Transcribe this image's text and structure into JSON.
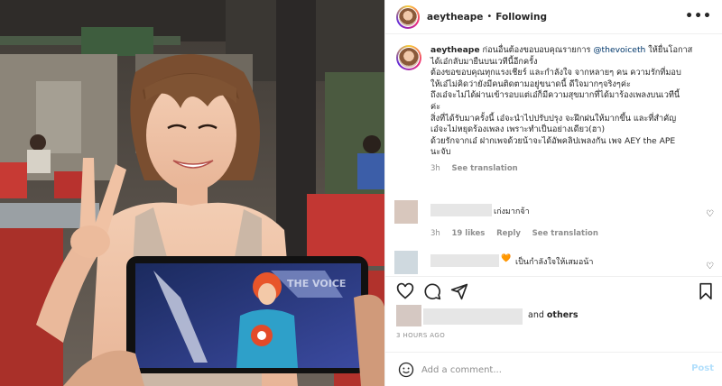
{
  "header": {
    "username": "aeytheape",
    "separator": "•",
    "follow_status": "Following",
    "more_icon": "•••"
  },
  "caption": {
    "username": "aeytheape",
    "text_before_mention": "ก่อนอื่นต้องขอบอบคุณรายการ",
    "mention": "@thevoiceth",
    "text_after_mention": "ให้ยื่นโอกาส",
    "lines": [
      "ได้เอ๋กลับมายืนบนเวทีนี้อีกครั้ง",
      "ต้องขอขอบคุณทุกแรงเชียร์ และกำลังใจ จากหลายๆ คน ความรักที่มอบ",
      "ให้เอ๋ไม่คิดว่ายังมีคนติดตามอยู่ขนาดนี้ ดีใจมากๆจริงๆค่ะ",
      "ถึงเอ๋จะไม่ได้ผ่านเข้ารอบแต่เอ๋ก็มีความสุขมากที่ได้มาร้องเพลงบนเวทีนี้",
      "ค่ะ",
      "สิ่งที่ได้รับมาครั้งนี้ เอ๋จะนำไปปรับปรุง จะฝึกฝนให้มากขึ้น และที่สำคัญ",
      "เอ๋จะไม่หยุดร้องเพลง เพราะทำเป็นอย่างเดียว(ฮา)",
      "ด้วยรักจากเอ๋ ฝากเพจด้วยน้าจะได้อัพคลิปเพลงกัน เพจ AEY the APE",
      "นะจับ"
    ],
    "age": "3h",
    "see_translation": "See translation"
  },
  "comments": [
    {
      "text": "เก่งมากจ้า",
      "age": "3h",
      "likes": "19 likes",
      "reply": "Reply",
      "see_translation": "See translation"
    },
    {
      "emoji": "🧡",
      "text": "เป็นกำลังใจให้เสมอน้า"
    }
  ],
  "likes": {
    "suffix": "and",
    "others": "others"
  },
  "timestamp": "3 HOURS AGO",
  "add_comment": {
    "placeholder": "Add a comment...",
    "post": "Post"
  },
  "photo": {
    "phone_overlay_text": "THE VOICE"
  },
  "colors": {
    "link": "#00376b",
    "muted": "#8e8e8e",
    "post_disabled": "#b2dffc"
  }
}
